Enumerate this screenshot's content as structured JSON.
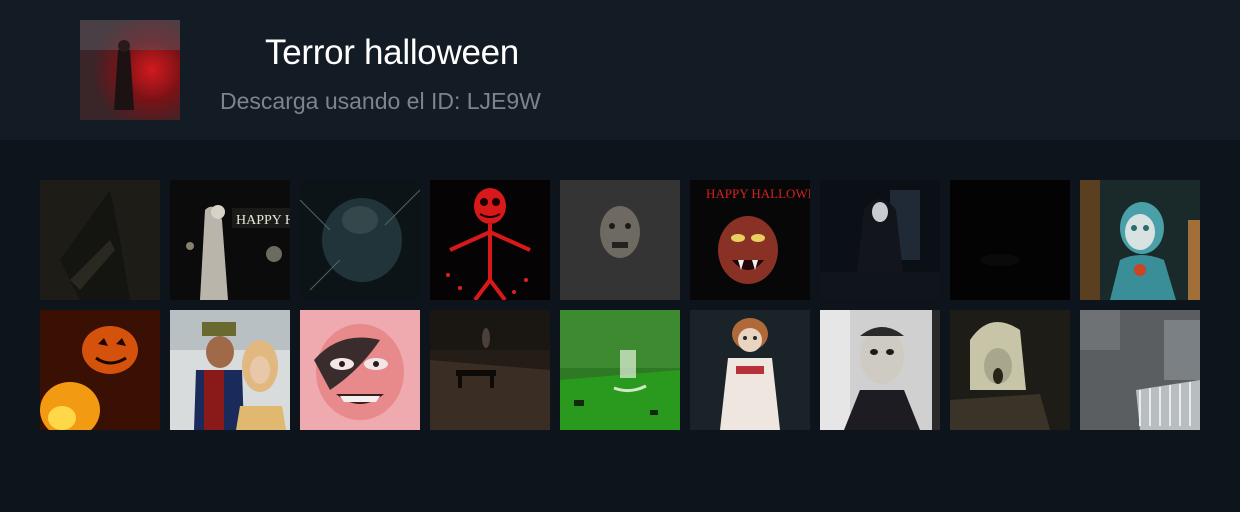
{
  "pack": {
    "title": "Terror halloween",
    "subtitle": "Descarga usando el ID: LJE9W"
  },
  "stickers": [
    {
      "id": 1,
      "name": "dark-hooded-figure"
    },
    {
      "id": 2,
      "name": "happy-halloween-ghost",
      "caption": "HAPPY HEL"
    },
    {
      "id": 3,
      "name": "creature-breaking-glass"
    },
    {
      "id": 4,
      "name": "jack-skellington"
    },
    {
      "id": 5,
      "name": "zombie-in-leaves"
    },
    {
      "id": 6,
      "name": "happy-halloween-vampire",
      "caption": "HAPPY HALLOWEEN"
    },
    {
      "id": 7,
      "name": "nun-in-hallway"
    },
    {
      "id": 8,
      "name": "dark-room"
    },
    {
      "id": 9,
      "name": "pennywise-clown"
    },
    {
      "id": 10,
      "name": "jack-o-lantern-fire"
    },
    {
      "id": 11,
      "name": "freddy-and-girl"
    },
    {
      "id": 12,
      "name": "pink-grinning-face"
    },
    {
      "id": 13,
      "name": "bench-in-night-park"
    },
    {
      "id": 14,
      "name": "green-rocking-chair"
    },
    {
      "id": 15,
      "name": "annabelle-doll"
    },
    {
      "id": 16,
      "name": "michael-myers-mask"
    },
    {
      "id": 17,
      "name": "screaming-old-woman"
    },
    {
      "id": 18,
      "name": "crib-night-vision"
    }
  ]
}
